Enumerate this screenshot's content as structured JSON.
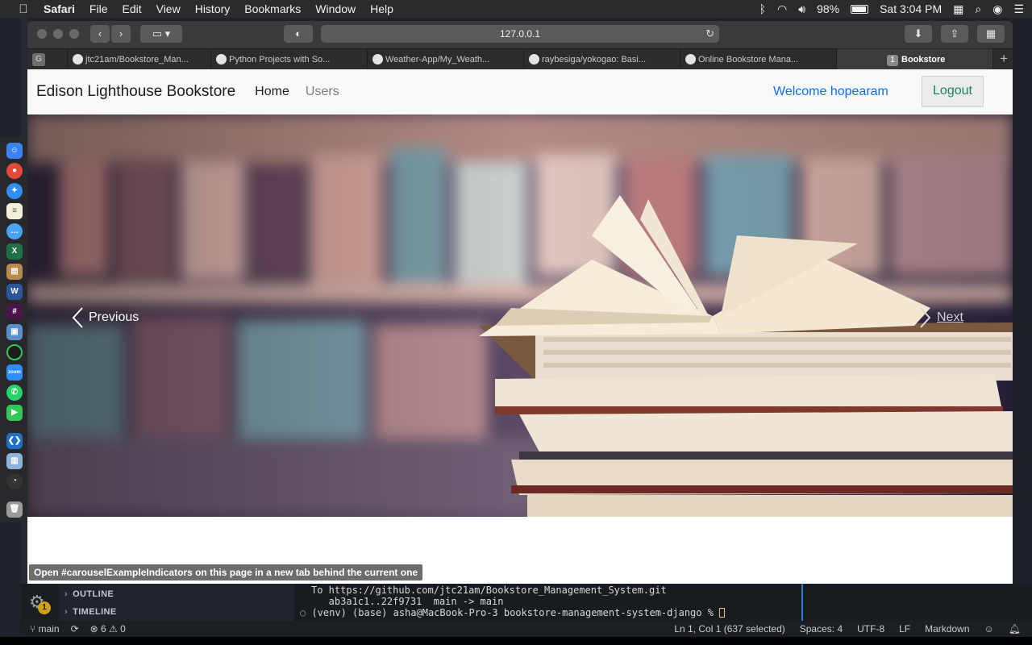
{
  "menubar": {
    "app": "Safari",
    "items": [
      "File",
      "Edit",
      "View",
      "History",
      "Bookmarks",
      "Window",
      "Help"
    ],
    "battery": "98%",
    "clock": "Sat 3:04 PM"
  },
  "browser": {
    "url": "127.0.0.1",
    "tabs": [
      {
        "label": "G"
      },
      {
        "label": "jtc21am/Bookstore_Man..."
      },
      {
        "label": "Python Projects with So..."
      },
      {
        "label": "Weather-App/My_Weath..."
      },
      {
        "label": "raybesiga/yokogao: Basi..."
      },
      {
        "label": "Online Bookstore Mana..."
      },
      {
        "label": "Bookstore",
        "number": "1"
      }
    ]
  },
  "page": {
    "brand": "Edison Lighthouse Bookstore",
    "nav": {
      "home": "Home",
      "users": "Users"
    },
    "welcome": "Welcome hopearam",
    "logout": "Logout",
    "carousel": {
      "previous": "Previous",
      "next": "Next"
    },
    "status_tooltip": "Open #carouselExampleIndicators on this page in a new tab behind the current one"
  },
  "vscode": {
    "sections": [
      "OUTLINE",
      "TIMELINE"
    ],
    "badge": "1",
    "terminal": [
      "To https://github.com/jtc21am/Bookstore_Management_System.git",
      "   ab3a1c1..22f9731  main -> main",
      "(venv) (base) asha@MacBook-Pro-3 bookstore-management-system-django % "
    ],
    "status": {
      "branch": "main",
      "errors": "6",
      "warnings": "0",
      "position": "Ln 1, Col 1 (637 selected)",
      "spaces": "Spaces: 4",
      "encoding": "UTF-8",
      "eol": "LF",
      "language": "Markdown"
    }
  }
}
